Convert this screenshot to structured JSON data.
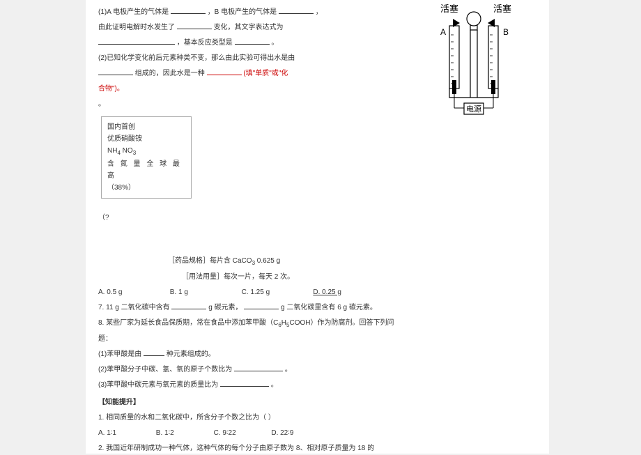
{
  "diagram": {
    "stopper_left": "活塞",
    "stopper_right": "活塞",
    "label_a": "A",
    "label_b": "B",
    "power": "电源"
  },
  "q1": {
    "pre_a": "(1)A 电极产生的气体是",
    "mid": "，B 电极产生的气体是",
    "tail": "，",
    "l2a": "由此证明电解时水发生了",
    "l2b": "变化，其文字表达式为",
    "l3b": "，基本反应类型是",
    "l3c": "。"
  },
  "q2": {
    "a": "(2)已知化学变化前后元素种类不变，那么由此实验可得出水是由",
    "b": "组成的，因此水是一种",
    "hint": "(填\"单质\"或\"化",
    "c": "合物\")。"
  },
  "period": "。",
  "box": {
    "l1": "国内首创",
    "l2": "优质硝酸铵",
    "l3a": "NH",
    "l3b": "4",
    "l3c": " NO",
    "l3d": "3",
    "l4": "含 氮 量 全 球 最 高",
    "l5": "（38%）"
  },
  "paren": "（?",
  "spec": {
    "label1": "［药品规格］每片含 CaCO",
    "sub3": "3",
    "val1": " 0.625 g",
    "label2": "［用法用量］每次一片，每天 2 次。"
  },
  "opts6": {
    "a": "A. 0.5 g",
    "b": "B. 1 g",
    "c": "C. 1.25 g",
    "d": "D. 0.25 g"
  },
  "q7": {
    "a": "7. 11 g 二氧化碳中含有",
    "b": "g 碳元素，",
    "c": " g 二氧化碳里含有 6 g 碳元素。"
  },
  "q8": {
    "a": "8. 某些厂家为延长食品保质期，常在食品中添加苯甲酸（C",
    "s1": "6",
    "a2": "H",
    "s2": "5",
    "a3": "COOH）作为防腐剂。回答下列问",
    "b": "题：",
    "p1a": "(1)苯甲酸是由",
    "p1b": "种元素组成的。",
    "p2a": "(2)苯甲酸分子中碳、氢、氧的原子个数比为",
    "p2b": "。",
    "p3a": "(3)苯甲酸中碳元素与氧元素的质量比为",
    "p3b": "。"
  },
  "section": "【知能提升】",
  "k1": {
    "q": "1. 相同质量的水和二氧化碳中，所含分子个数之比为（    ）",
    "a": "A. 1∶1",
    "b": "B. 1∶2",
    "c": "C. 9∶22",
    "d": "D. 22∶9"
  },
  "k2": "2. 我国近年研制成功一种气体，这种气体的每个分子由原子数为 8、相对原子质量为 18 的"
}
